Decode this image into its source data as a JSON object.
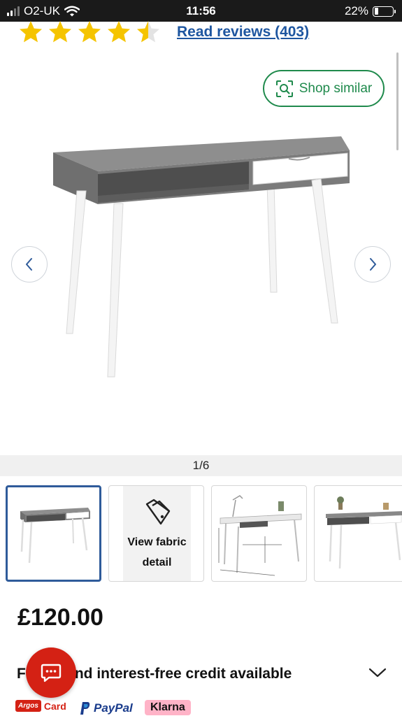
{
  "status_bar": {
    "carrier": "O2-UK",
    "time": "11:56",
    "battery_percent": "22%",
    "battery_level": 0.22,
    "signal_bars_filled": 2,
    "signal_bars_total": 4
  },
  "rating": {
    "stars_filled": 4.5,
    "stars_total": 5,
    "reviews_link": "Read reviews (403)"
  },
  "gallery": {
    "shop_similar_label": "Shop similar",
    "counter": "1/6",
    "thumbnails": [
      {
        "type": "image",
        "active": true
      },
      {
        "type": "fabric",
        "label_line1": "View fabric",
        "label_line2": "detail"
      },
      {
        "type": "image",
        "active": false
      },
      {
        "type": "image",
        "active": false
      }
    ]
  },
  "product": {
    "price": "£120.00",
    "credit_text": "F          and interest-free credit available"
  },
  "payments": {
    "argos_logo": "Argos",
    "argos_card_label": "Card",
    "paypal_label": "PayPal",
    "klarna_label": "Klarna"
  },
  "colors": {
    "star": "#f5c400",
    "link": "#1e56a0",
    "shop_similar": "#1f8a4c",
    "active_thumb_border": "#2f5b9a",
    "chat": "#d42114",
    "klarna_bg": "#ffb3c7"
  },
  "icons": {
    "shop_similar": "visual-search-icon",
    "prev": "chevron-left-icon",
    "next": "chevron-right-icon",
    "fabric": "fabric-swatch-icon",
    "credit_expand": "chevron-down-icon",
    "chat": "chat-icon"
  }
}
